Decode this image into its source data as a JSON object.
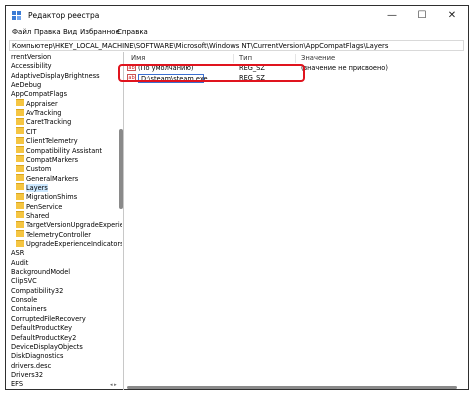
{
  "window": {
    "title": "Редактор реестра",
    "controls": {
      "minimize": "—",
      "maximize": "☐",
      "close": "✕"
    }
  },
  "menu": [
    "Файл",
    "Правка",
    "Вид",
    "Избранное",
    "Справка"
  ],
  "address": "Компьютер\\HKEY_LOCAL_MACHINE\\SOFTWARE\\Microsoft\\Windows NT\\CurrentVersion\\AppCompatFlags\\Layers",
  "tree": {
    "items": [
      {
        "label": "rrentVersion",
        "folder": false,
        "indent": 0
      },
      {
        "label": "Accessibility",
        "folder": false,
        "indent": 0
      },
      {
        "label": "AdaptiveDisplayBrightness",
        "folder": false,
        "indent": 0
      },
      {
        "label": "AeDebug",
        "folder": false,
        "indent": 0
      },
      {
        "label": "AppCompatFlags",
        "folder": false,
        "indent": 0
      },
      {
        "label": "Appraiser",
        "folder": true,
        "indent": 1
      },
      {
        "label": "AvTracking",
        "folder": true,
        "indent": 1
      },
      {
        "label": "CaretTracking",
        "folder": true,
        "indent": 1
      },
      {
        "label": "CIT",
        "folder": true,
        "indent": 1
      },
      {
        "label": "ClientTelemetry",
        "folder": true,
        "indent": 1
      },
      {
        "label": "Compatibility Assistant",
        "folder": true,
        "indent": 1
      },
      {
        "label": "CompatMarkers",
        "folder": true,
        "indent": 1
      },
      {
        "label": "Custom",
        "folder": true,
        "indent": 1
      },
      {
        "label": "GeneralMarkers",
        "folder": true,
        "indent": 1
      },
      {
        "label": "Layers",
        "folder": true,
        "indent": 1,
        "selected": true
      },
      {
        "label": "MigrationShims",
        "folder": true,
        "indent": 1
      },
      {
        "label": "PenService",
        "folder": true,
        "indent": 1
      },
      {
        "label": "Shared",
        "folder": true,
        "indent": 1
      },
      {
        "label": "TargetVersionUpgradeExperienceInd",
        "folder": true,
        "indent": 1
      },
      {
        "label": "TelemetryController",
        "folder": true,
        "indent": 1
      },
      {
        "label": "UpgradeExperienceIndicators",
        "folder": true,
        "indent": 1
      },
      {
        "label": "ASR",
        "folder": false,
        "indent": 0
      },
      {
        "label": "Audit",
        "folder": false,
        "indent": 0
      },
      {
        "label": "BackgroundModel",
        "folder": false,
        "indent": 0
      },
      {
        "label": "ClipSVC",
        "folder": false,
        "indent": 0
      },
      {
        "label": "Compatibility32",
        "folder": false,
        "indent": 0
      },
      {
        "label": "Console",
        "folder": false,
        "indent": 0
      },
      {
        "label": "Containers",
        "folder": false,
        "indent": 0
      },
      {
        "label": "CorruptedFileRecovery",
        "folder": false,
        "indent": 0
      },
      {
        "label": "DefaultProductKey",
        "folder": false,
        "indent": 0
      },
      {
        "label": "DefaultProductKey2",
        "folder": false,
        "indent": 0
      },
      {
        "label": "DeviceDisplayObjects",
        "folder": false,
        "indent": 0
      },
      {
        "label": "DiskDiagnostics",
        "folder": false,
        "indent": 0
      },
      {
        "label": "drivers.desc",
        "folder": false,
        "indent": 0
      },
      {
        "label": "Drivers32",
        "folder": false,
        "indent": 0
      },
      {
        "label": "EFS",
        "folder": false,
        "indent": 0
      }
    ]
  },
  "values_pane": {
    "columns": [
      "Имя",
      "Тип",
      "Значение"
    ],
    "rows": [
      {
        "name": "(По умолчанию)",
        "type": "REG_SZ",
        "value": "(значение не присвоено)"
      },
      {
        "name": "D:\\steam\\steam.exe",
        "type": "REG_SZ",
        "value": "",
        "editing": true
      }
    ]
  },
  "colors": {
    "highlight": "#e0141e",
    "selection": "#cce8ff"
  }
}
